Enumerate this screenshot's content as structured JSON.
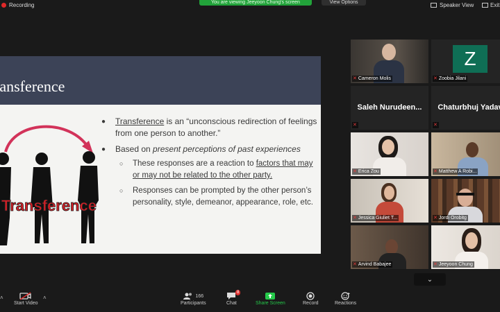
{
  "top": {
    "recording_label": "Recording",
    "banner_text": "You are viewing Jeeyoon Chung's screen",
    "view_options_label": "View Options",
    "speaker_view_label": "Speaker View",
    "exit_label": "Exit"
  },
  "slide": {
    "title": "ransference",
    "figure_word": "Transference",
    "bullet1_term": "Transference",
    "bullet1_rest": " is an “unconscious redirection of feelings from one person to another.”",
    "bullet2_prefix": "Based on ",
    "bullet2_italic": "present perceptions of past experiences",
    "sub1_prefix": "These responses are a reaction to ",
    "sub1_underlined": "factors that may or may not be related to the other party.",
    "sub2": "Responses can be prompted by the other person’s personality, style, demeanor, appearance, role, etc."
  },
  "participants": [
    {
      "name": "Cameron Molis"
    },
    {
      "name": "Zoobia Jilani",
      "initial": "Z"
    },
    {
      "name": "Saleh  Nurudeen..."
    },
    {
      "name": "Chaturbhuj Yadav"
    },
    {
      "name": "Erica Zou"
    },
    {
      "name": "Matthew A Robi..."
    },
    {
      "name": "Jessica Giuliet T..."
    },
    {
      "name": "Jordi Orobitg"
    },
    {
      "name": "Arvind Babajee"
    },
    {
      "name": "Jeeyoon Chung"
    }
  ],
  "toolbar": {
    "start_video": "Start Video",
    "participants": "Participants",
    "participants_count": "166",
    "chat": "Chat",
    "chat_badge": "8",
    "share_screen": "Share Screen",
    "record": "Record",
    "reactions": "Reactions"
  },
  "colors": {
    "share_green": "#25c94a",
    "slide_header": "#3c4357",
    "active_speaker": "#c8d95a"
  }
}
